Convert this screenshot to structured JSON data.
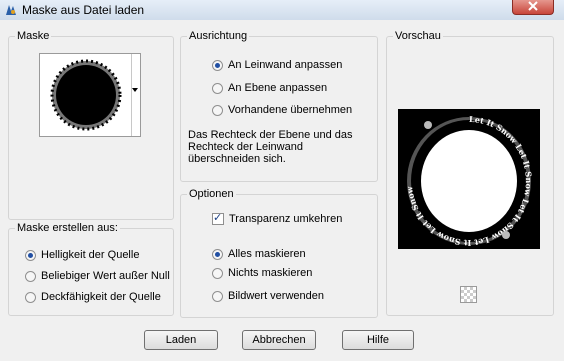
{
  "window": {
    "title": "Maske aus Datei laden"
  },
  "maske": {
    "label": "Maske"
  },
  "ausrichtung": {
    "label": "Ausrichtung",
    "options": [
      {
        "label": "An Leinwand anpassen",
        "selected": true
      },
      {
        "label": "An Ebene anpassen",
        "selected": false
      },
      {
        "label": "Vorhandene übernehmen",
        "selected": false
      }
    ],
    "description": "Das Rechteck der Ebene und das Rechteck der Leinwand überschneiden sich."
  },
  "optionen": {
    "label": "Optionen",
    "invert_label": "Transparenz umkehren",
    "invert_checked": true,
    "options": [
      {
        "label": "Alles maskieren",
        "selected": true
      },
      {
        "label": "Nichts maskieren",
        "selected": false
      },
      {
        "label": "Bildwert verwenden",
        "selected": false
      }
    ]
  },
  "erstellen": {
    "label": "Maske erstellen aus:",
    "options": [
      {
        "label": "Helligkeit der Quelle",
        "selected": true
      },
      {
        "label": "Beliebiger Wert außer Null",
        "selected": false
      },
      {
        "label": "Deckfähigkeit der Quelle",
        "selected": false
      }
    ]
  },
  "vorschau": {
    "label": "Vorschau",
    "ring_text": "Let It Snow Let It Snow Let It Snow Let It Snow Let It Snow"
  },
  "buttons": {
    "laden": "Laden",
    "abbrechen": "Abbrechen",
    "hilfe": "Hilfe"
  }
}
